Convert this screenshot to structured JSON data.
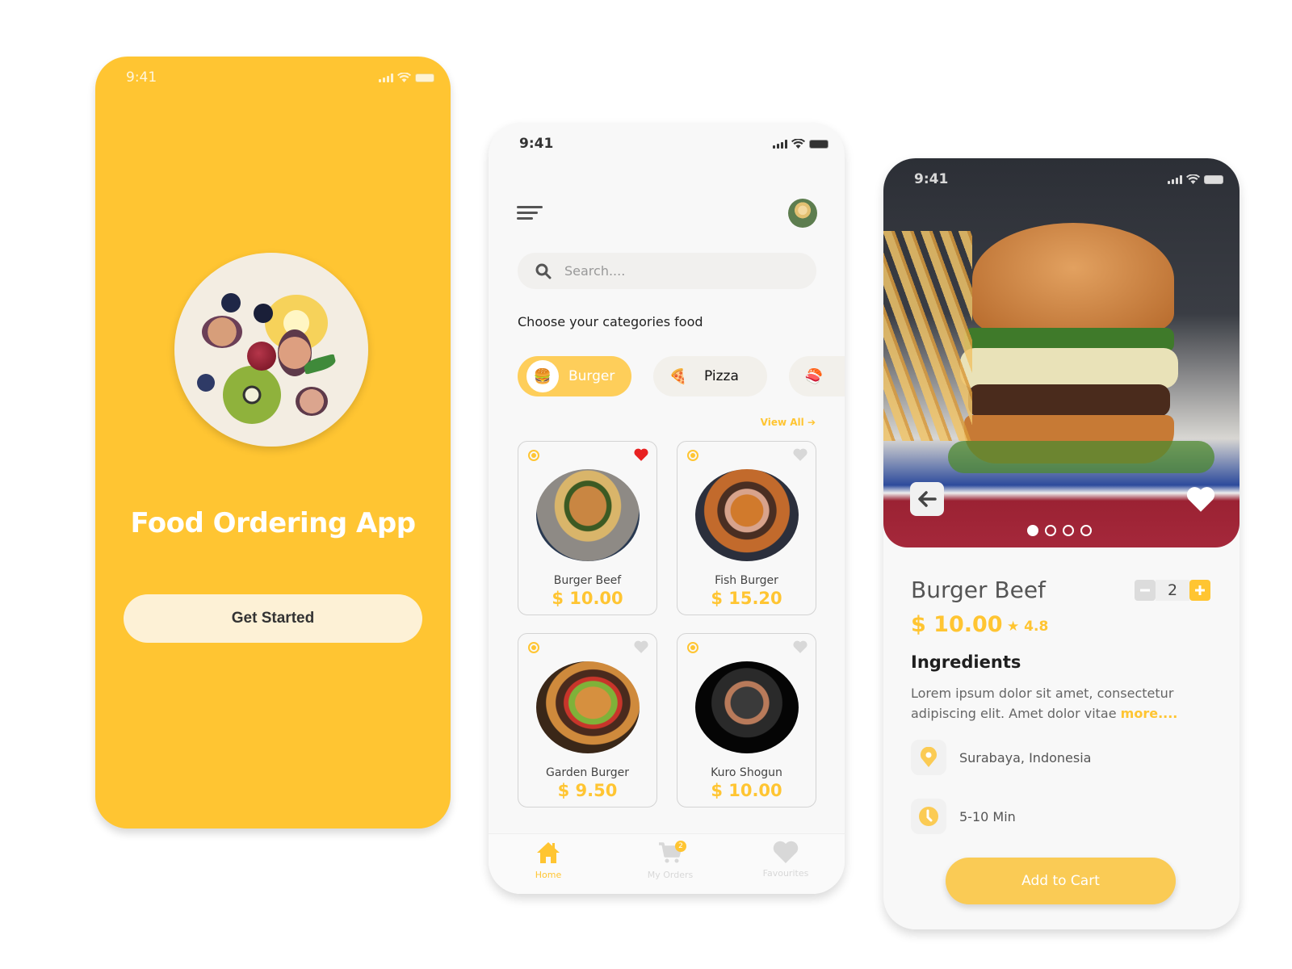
{
  "colors": {
    "accent": "#FFC532",
    "splash_bg": "#FFC532",
    "heart_active": "#E82222"
  },
  "status_bar": {
    "time": "9:41"
  },
  "splash": {
    "title": "Food Ordering App",
    "button_label": "Get Started",
    "image": "fruit-bowl"
  },
  "home": {
    "search_placeholder": "Search....",
    "section_title": "Choose your categories food",
    "categories": [
      {
        "label": "Burger",
        "icon": "burger-icon",
        "active": true
      },
      {
        "label": "Pizza",
        "icon": "pizza-icon",
        "active": false
      },
      {
        "label": "",
        "icon": "sushi-icon",
        "active": false
      }
    ],
    "view_all_label": "View All",
    "products": [
      {
        "name": "Burger Beef",
        "price": "$ 10.00",
        "favourite": true
      },
      {
        "name": "Fish Burger",
        "price": "$ 15.20",
        "favourite": false
      },
      {
        "name": "Garden Burger",
        "price": "$ 9.50",
        "favourite": false
      },
      {
        "name": "Kuro Shogun",
        "price": "$ 10.00",
        "favourite": false
      }
    ],
    "nav": [
      {
        "label": "Home",
        "active": true
      },
      {
        "label": "My Orders",
        "badge": "2",
        "active": false
      },
      {
        "label": "Favourites",
        "active": false
      }
    ]
  },
  "detail": {
    "name": "Burger Beef",
    "price": "$ 10.00",
    "rating": "★ 4.8",
    "quantity": "2",
    "carousel": {
      "total": 4,
      "active_index": 0
    },
    "ingredients_title": "Ingredients",
    "ingredients_text": "Lorem ipsum dolor sit amet, consectetur adipiscing elit. Amet dolor vitae ",
    "more_label": "more....",
    "location": "Surabaya, Indonesia",
    "time": "5-10 Min",
    "add_to_cart_label": "Add to Cart"
  }
}
